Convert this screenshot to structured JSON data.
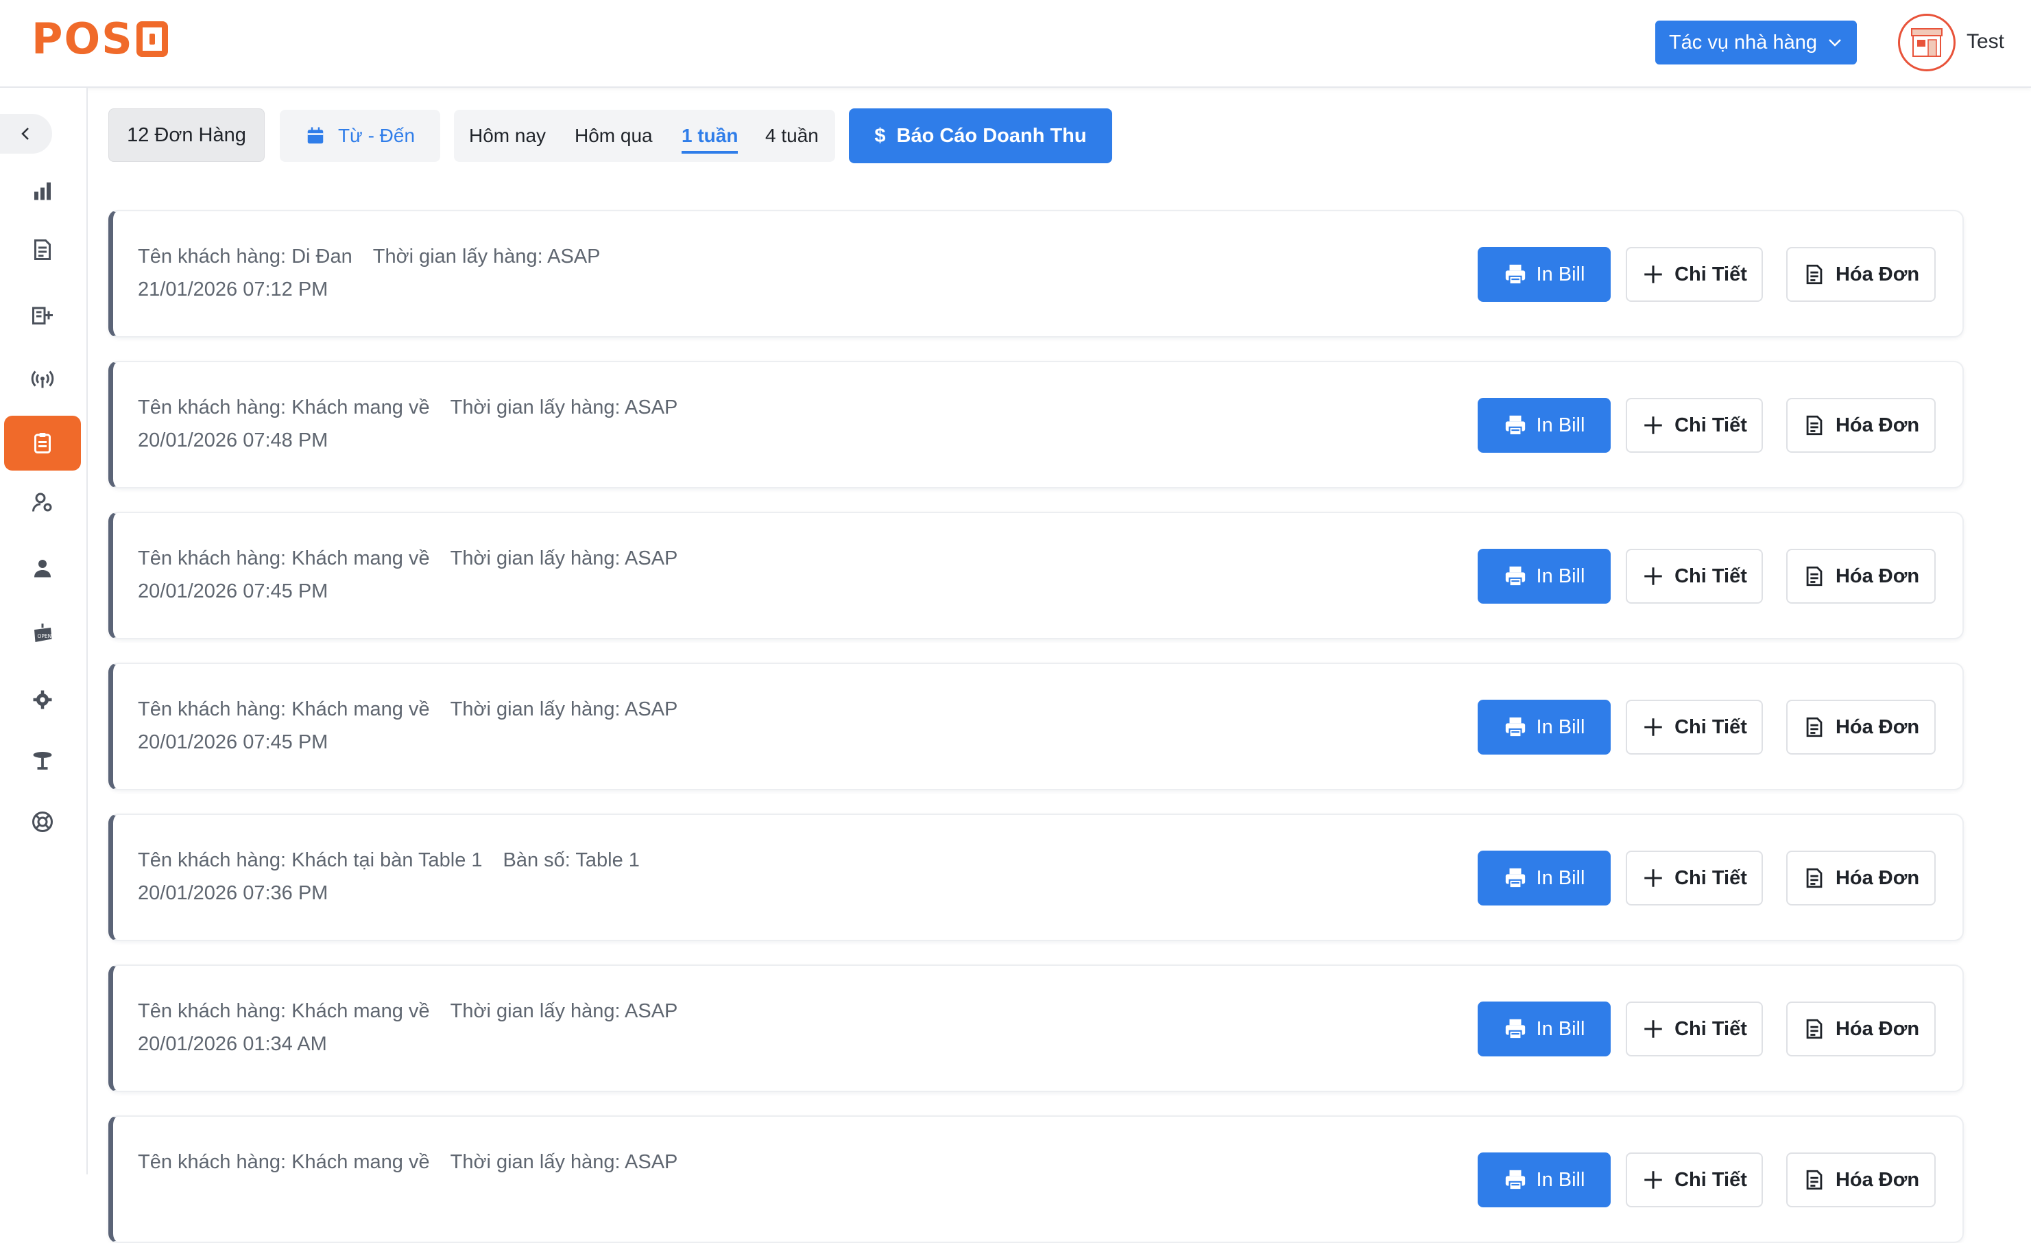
{
  "header": {
    "logo_text": "POS",
    "action_menu_label": "Tác vụ nhà hàng",
    "username": "Test"
  },
  "sidebar": {
    "items": [
      {
        "icon": "chart-bar-icon"
      },
      {
        "icon": "document-list-icon"
      },
      {
        "icon": "building-add-icon"
      },
      {
        "icon": "broadcast-icon"
      },
      {
        "icon": "clipboard-icon",
        "active": true
      },
      {
        "icon": "user-settings-icon"
      },
      {
        "icon": "user-icon"
      },
      {
        "icon": "open-sign-icon"
      },
      {
        "icon": "gear-icon"
      },
      {
        "icon": "table-icon"
      },
      {
        "icon": "lifebuoy-icon"
      }
    ]
  },
  "toolbar": {
    "order_count": "12 Đơn Hàng",
    "date_range_label": "Từ - Đến",
    "range_tabs": [
      "Hôm nay",
      "Hôm qua",
      "1 tuần",
      "4 tuần"
    ],
    "active_range": "1 tuần",
    "report_label": "Báo Cáo Doanh Thu"
  },
  "buttons": {
    "print_label": "In Bill",
    "detail_label": "Chi Tiết",
    "invoice_label": "Hóa Đơn"
  },
  "orders": [
    {
      "customer": "Tên khách hàng: Di Đan",
      "extra": "Thời gian lấy hàng: ASAP",
      "datetime": "21/01/2026 07:12 PM"
    },
    {
      "customer": "Tên khách hàng: Khách mang về",
      "extra": "Thời gian lấy hàng: ASAP",
      "datetime": "20/01/2026 07:48 PM"
    },
    {
      "customer": "Tên khách hàng: Khách mang về",
      "extra": "Thời gian lấy hàng: ASAP",
      "datetime": "20/01/2026 07:45 PM"
    },
    {
      "customer": "Tên khách hàng: Khách mang về",
      "extra": "Thời gian lấy hàng: ASAP",
      "datetime": "20/01/2026 07:45 PM"
    },
    {
      "customer": "Tên khách hàng: Khách tại bàn Table 1",
      "extra": "Bàn số: Table 1",
      "datetime": "20/01/2026 07:36 PM"
    },
    {
      "customer": "Tên khách hàng: Khách mang về",
      "extra": "Thời gian lấy hàng: ASAP",
      "datetime": "20/01/2026 01:34 AM"
    },
    {
      "customer": "Tên khách hàng: Khách mang về",
      "extra": "Thời gian lấy hàng: ASAP",
      "datetime": ""
    }
  ],
  "colors": {
    "brand": "#f06a2a",
    "primary": "#2f7de9"
  }
}
